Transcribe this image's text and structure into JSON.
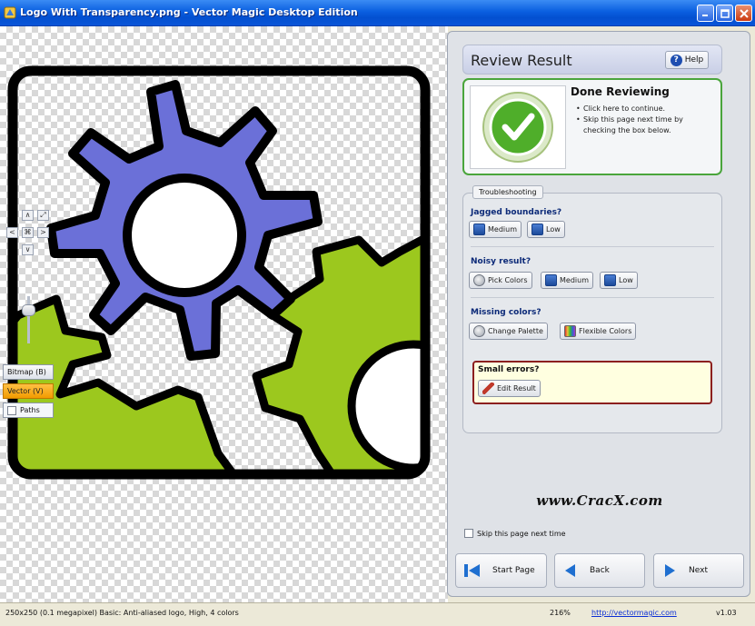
{
  "window": {
    "title": "Logo With Transparency.png - Vector Magic Desktop Edition"
  },
  "canvas_nav": {
    "up": "∧",
    "down": "∨",
    "left": "<",
    "right": ">",
    "center": "⌘",
    "fit": "⤢",
    "zoom_level": 0.8
  },
  "view_toggle": {
    "bitmap_label": "Bitmap (B)",
    "vector_label": "Vector (V)",
    "paths_label": "Paths",
    "selected": "vector",
    "paths_checked": false
  },
  "panel": {
    "header_title": "Review Result",
    "help_label": "Help",
    "done": {
      "title": "Done Reviewing",
      "bullets": [
        "Click here to continue.",
        "Skip this page next time by checking the box below."
      ]
    },
    "troubleshooting": {
      "tab_label": "Troubleshooting",
      "jagged": {
        "label": "Jagged boundaries?",
        "buttons": [
          "Medium",
          "Low"
        ]
      },
      "noisy": {
        "label": "Noisy result?",
        "buttons": [
          "Pick Colors",
          "Medium",
          "Low"
        ]
      },
      "missing": {
        "label": "Missing colors?",
        "buttons": [
          "Change Palette",
          "Flexible Colors"
        ]
      },
      "small_errors": {
        "label": "Small errors?",
        "button": "Edit Result"
      }
    },
    "watermark": "www.CracX.com",
    "skip_label": "Skip this page next time",
    "skip_checked": false,
    "nav": {
      "start": "Start Page",
      "back": "Back",
      "next": "Next"
    }
  },
  "status": {
    "info": "250x250 (0.1 megapixel) Basic: Anti-aliased logo, High, 4 colors",
    "zoom": "216%",
    "link": "http://vectormagic.com",
    "version": "v1.03"
  },
  "colors": {
    "gear_blue": "#6b70d8",
    "gear_green": "#9cc81e",
    "outline": "#000000",
    "title_bar": "#0a5fe0",
    "done_border": "#4aa53c",
    "error_border": "#8c1f1f"
  }
}
